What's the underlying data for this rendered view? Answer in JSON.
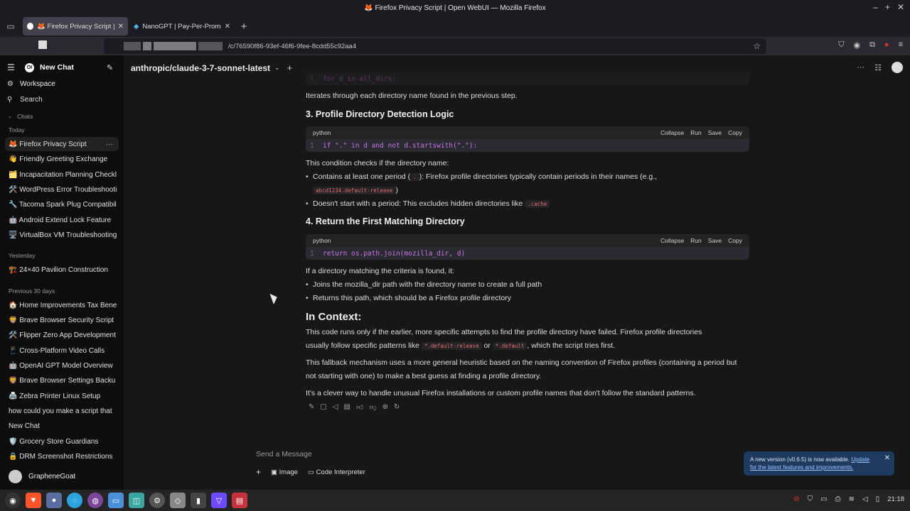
{
  "window": {
    "title": "🦊 Firefox Privacy Script | Open WebUI — Mozilla Firefox",
    "controls": [
      "–",
      "+",
      "✕"
    ]
  },
  "tabs": [
    {
      "label": "🦊 Firefox Privacy Script | O",
      "active": true
    },
    {
      "label": "NanoGPT | Pay-Per-Prompt",
      "active": false
    }
  ],
  "url": {
    "value": "/c/76590f86-93ef-46f6-9fee-8cdd55c92aa4"
  },
  "sidebar": {
    "new_chat": "New Chat",
    "workspace": "Workspace",
    "search": "Search",
    "chats_label": "Chats",
    "sections": [
      {
        "label": "Today",
        "items": [
          "🦊 Firefox Privacy Script",
          "👋 Friendly Greeting Exchange",
          "🗂️ Incapacitation Planning Checkl",
          "🛠️ WordPress Error Troubleshooti",
          "🔧 Tacoma Spark Plug Compatibil",
          "🤖 Android Extend Lock Feature",
          "🖥️ VirtualBox VM Troubleshooting"
        ]
      },
      {
        "label": "Yesterday",
        "items": [
          "🏗️ 24×40 Pavilion Construction"
        ]
      },
      {
        "label": "Previous 30 days",
        "items": [
          "🏠 Home Improvements Tax Bene",
          "🦁 Brave Browser Security Script",
          "🛠️ Flipper Zero App Development",
          "📱 Cross-Platform Video Calls",
          "🤖 OpenAI GPT Model Overview",
          "🦁 Brave Browser Settings Backu",
          "🖨️ Zebra Printer Linux Setup",
          "how could you make a script that",
          "New Chat",
          "🛡️ Grocery Store Guardians",
          "🔒 DRM Screenshot Restrictions"
        ]
      }
    ],
    "user": "GrapheneGoat"
  },
  "header": {
    "model": "anthropic/claude-3-7-sonnet-latest"
  },
  "content": {
    "prev_code": "for d in all_dirs:",
    "p1": "Iterates through each directory name found in the previous step.",
    "h3": "3. Profile Directory Detection Logic",
    "code_lang": "python",
    "code_actions": [
      "Collapse",
      "Run",
      "Save",
      "Copy"
    ],
    "code1": "if \".\" in d and not d.startswith(\".\"):",
    "p2": "This condition checks if the directory name:",
    "b1a": "Contains at least one period (",
    "b1code": ".",
    "b1b": "): Firefox profile directories typically contain periods in their names (e.g.,",
    "b1code2": "abcd1234.default-release",
    "b1c": ")",
    "b2": "Doesn't start with a period: This excludes hidden directories like",
    "b2code": ".cache",
    "h4": "4. Return the First Matching Directory",
    "code2": "return os.path.join(mozilla_dir, d)",
    "p3": "If a directory matching the criteria is found, it:",
    "b3": "Joins the mozilla_dir path with the directory name to create a full path",
    "b4": "Returns this path, which should be a Firefox profile directory",
    "h_context": "In Context:",
    "p4a": "This code runs only if the earlier, more specific attempts to find the profile directory have failed. Firefox profile directories",
    "p4b": "usually follow specific patterns like",
    "p4c1": "*.default-release",
    "p4or": "or",
    "p4c2": "*.default",
    "p4d": ", which the script tries first.",
    "p5": "This fallback mechanism uses a more general heuristic based on the naming convention of Firefox profiles (containing a period but not starting with one) to make a best guess at finding a profile directory.",
    "p6": "It's a clever way to handle unusual Firefox installations or custom profile names that don't follow the standard patterns."
  },
  "input": {
    "placeholder": "Send a Message",
    "image": "Image",
    "code_interpreter": "Code Interpreter"
  },
  "notice": {
    "text": "A new version (v0.6.5) is now available.",
    "link1": "Update",
    "link2": "for the latest features and improvements."
  },
  "clock": "21:18"
}
